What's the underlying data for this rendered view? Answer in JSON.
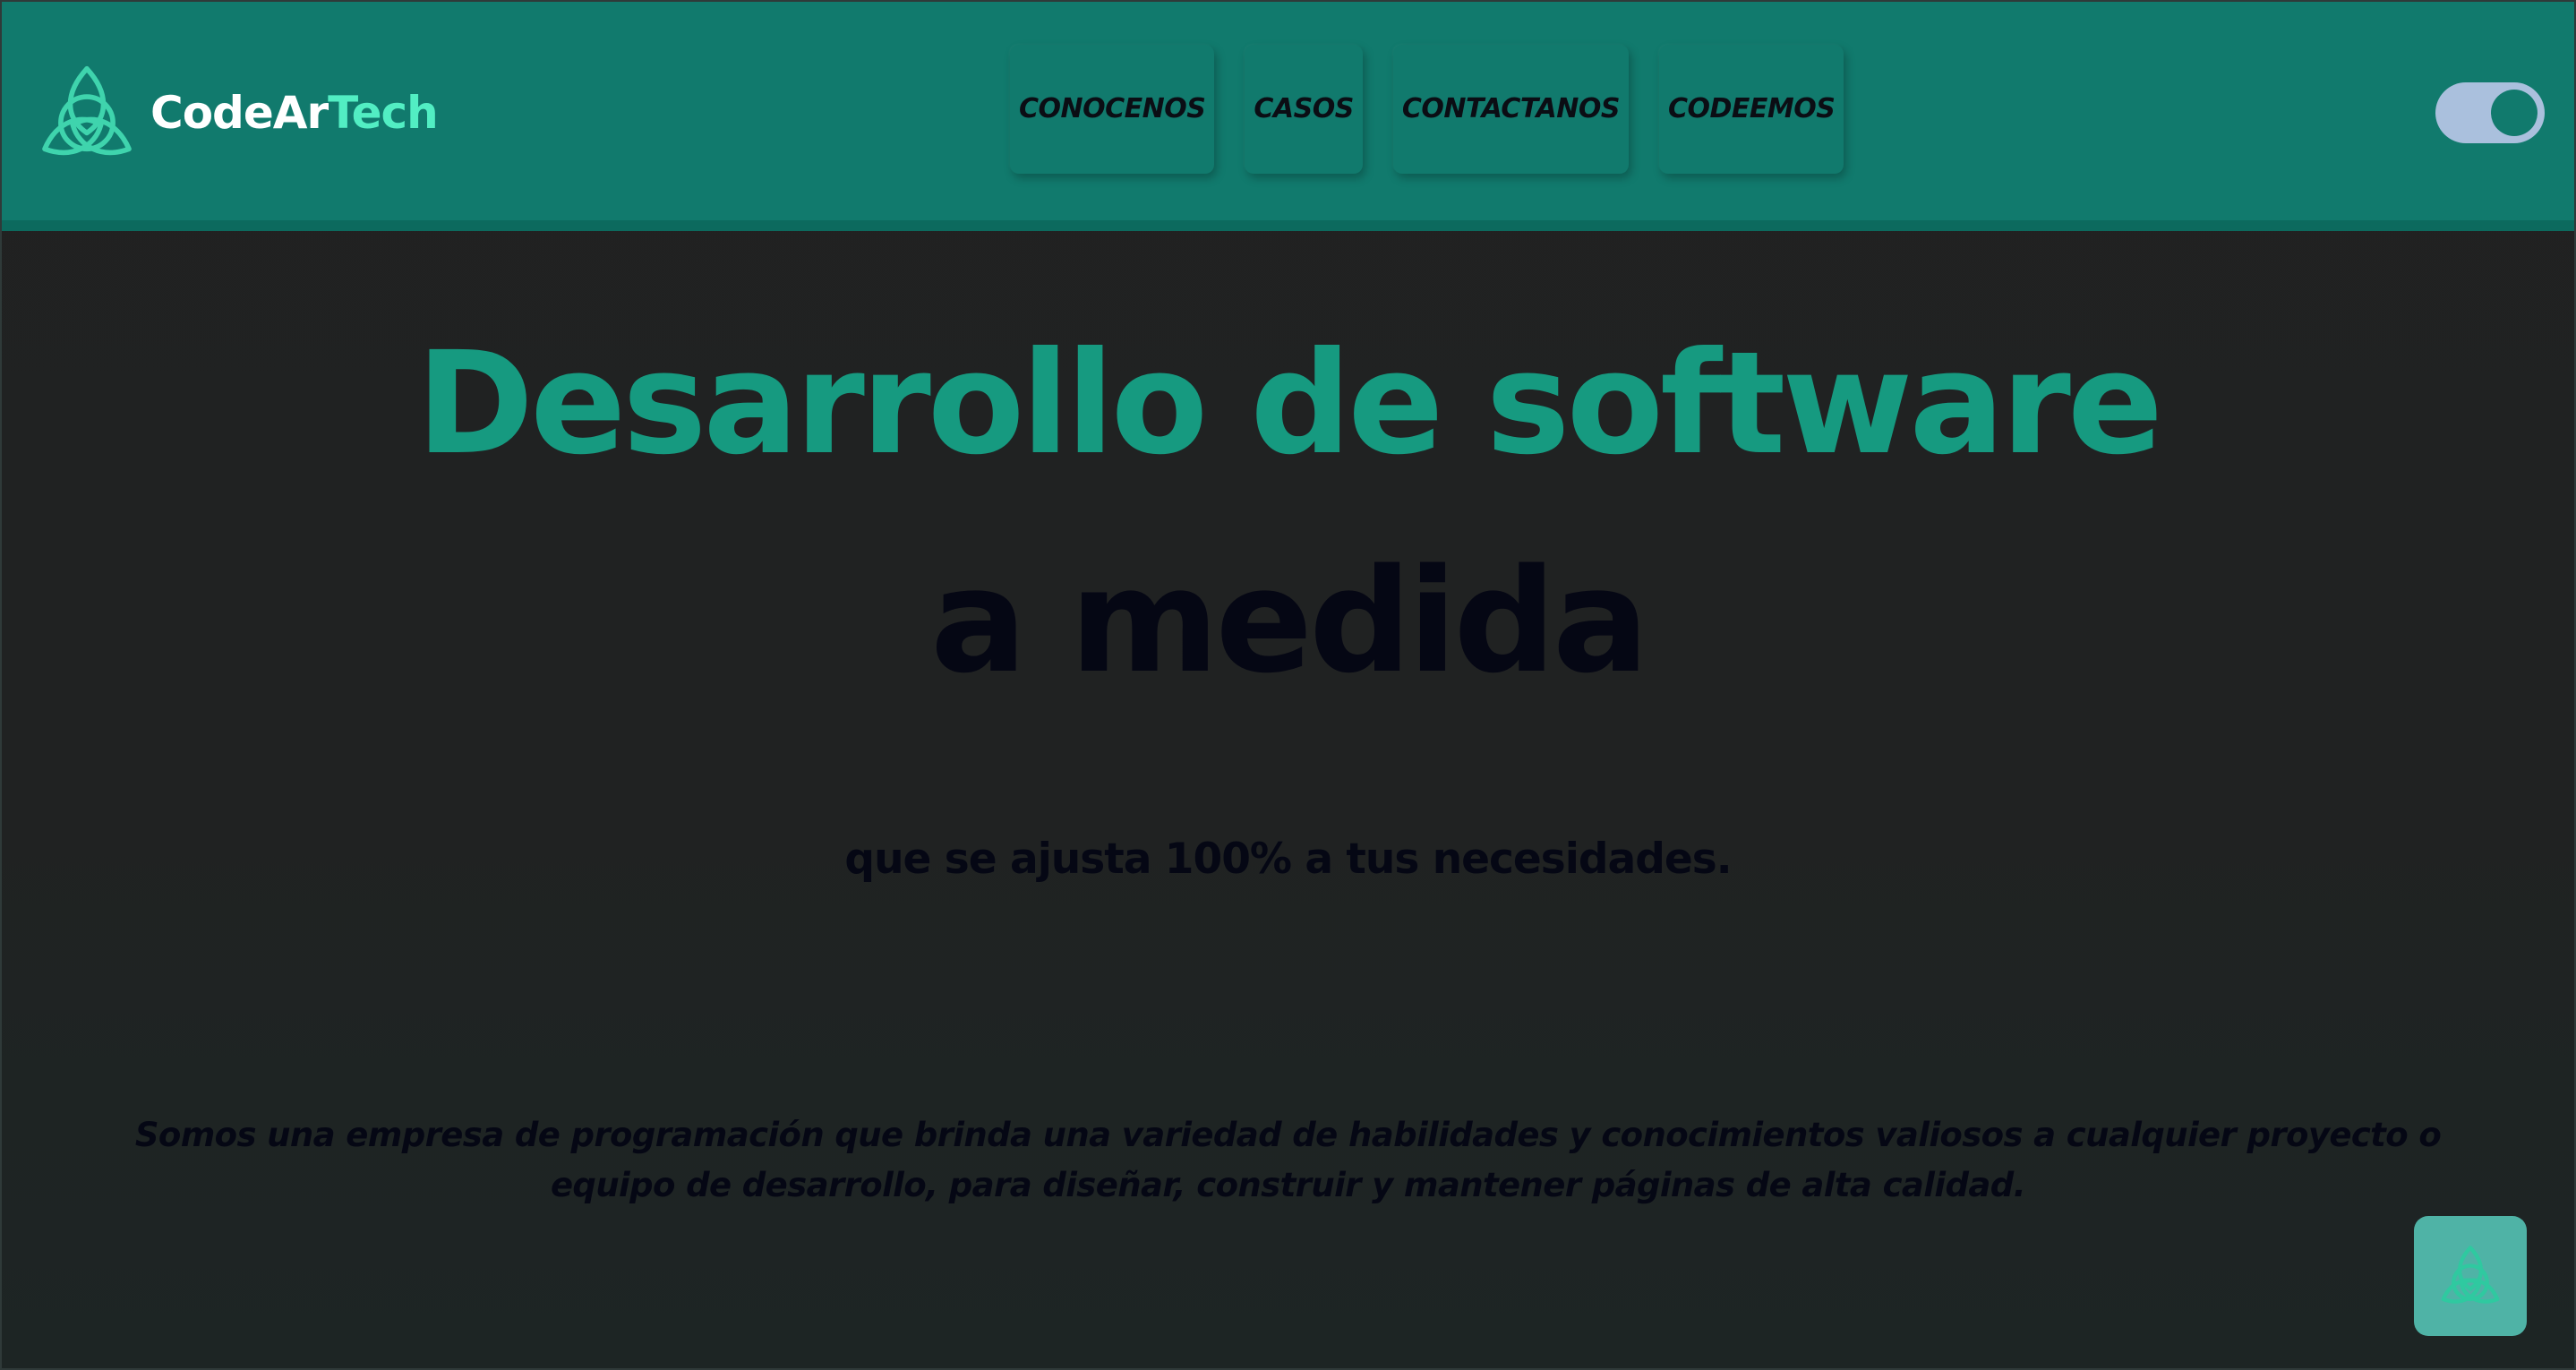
{
  "header": {
    "logo_icon": "triquetra-knot-icon",
    "brand_part_1": "CodeAr",
    "brand_part_2": "Tech",
    "nav": [
      {
        "label": "CONOCENOS"
      },
      {
        "label": "CASOS"
      },
      {
        "label": "CONTACTANOS"
      },
      {
        "label": "CODEEMOS"
      }
    ],
    "theme_toggle": {
      "state": "on"
    }
  },
  "hero": {
    "title_line_1": "Desarrollo de software",
    "title_line_2": "a medida",
    "subtitle": "que se ajusta 100% a tus necesidades.",
    "description": "Somos una empresa de programación que brinda una variedad de habilidades y conocimientos valiosos a cualquier proyecto o equipo de desarrollo, para diseñar, construir y mantener páginas de alta calidad."
  },
  "floating_button": {
    "icon": "triquetra-knot-icon"
  },
  "colors": {
    "header_bg": "#117a6d",
    "accent": "#169a80",
    "brand_highlight": "#52eec3",
    "page_bg": "#212121",
    "dark_text": "#050714",
    "toggle_track": "#aac0dd"
  }
}
